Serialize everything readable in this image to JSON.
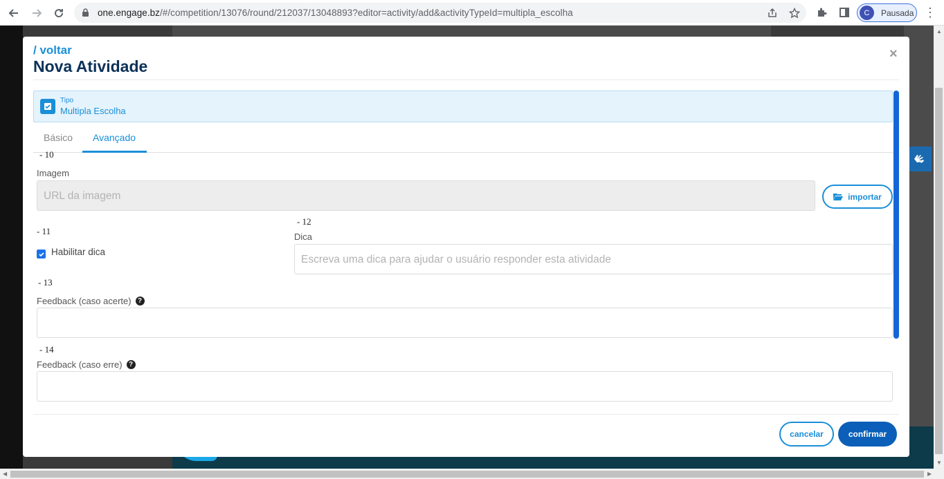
{
  "browser": {
    "url_domain": "one.engage.bz",
    "url_path": "/#/competition/13076/round/212037/13048893?editor=activity/add&activityTypeId=multipla_escolha",
    "profile_initial": "C",
    "profile_status": "Pausada"
  },
  "modal": {
    "back_label": "/ voltar",
    "title": "Nova Atividade",
    "close_label": "×",
    "type_label": "Tipo",
    "type_value": "Multipla Escolha",
    "tabs": [
      {
        "label": "Básico",
        "active": false
      },
      {
        "label": "Avançado",
        "active": true
      }
    ],
    "fields": {
      "imagem": {
        "number": "- 10",
        "label": "Imagem",
        "placeholder": "URL da imagem",
        "import_label": "importar"
      },
      "habilitar_dica": {
        "number": "- 11",
        "label": "Habilitar dica",
        "checked": true
      },
      "dica": {
        "number": "- 12",
        "label": "Dica",
        "placeholder": "Escreva uma dica para ajudar o usuário responder esta atividade"
      },
      "feedback_acerte": {
        "number": "- 13",
        "label": "Feedback (caso acerte)",
        "help": "?"
      },
      "feedback_erre": {
        "number": "- 14",
        "label": "Feedback (caso erre)",
        "help": "?"
      }
    },
    "cancel_label": "cancelar",
    "confirm_label": "confirmar"
  },
  "colors": {
    "accent": "#1a8fd8",
    "title": "#0b3158",
    "confirm_bg": "#0b5fb8"
  }
}
